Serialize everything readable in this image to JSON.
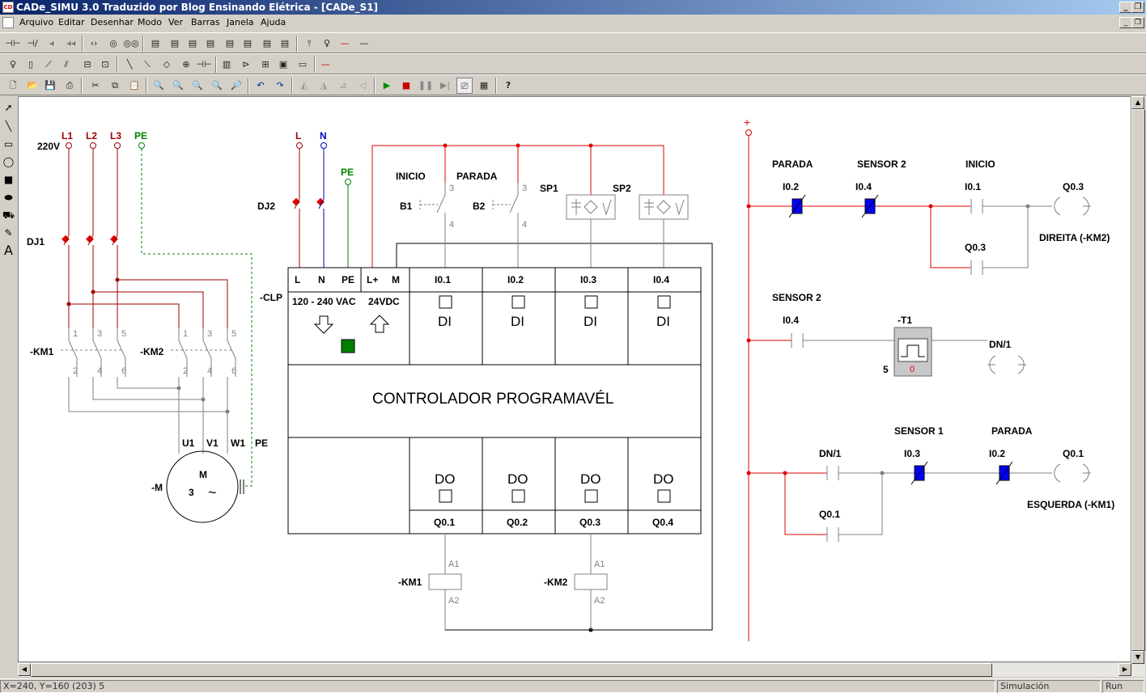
{
  "window": {
    "title": "CADe_SIMU 3.0 Traduzido por Blog Ensinando Elétrica - [CADe_S1]",
    "app_icon": "cade-simu-icon"
  },
  "menu": [
    "Arquivo",
    "Editar",
    "Desenhar",
    "Modo",
    "Ver",
    "Barras",
    "Janela",
    "Ajuda"
  ],
  "status": {
    "coords": "X=240, Y=160 (203) 5",
    "mode": "Simulación",
    "state": "Run"
  },
  "colors": {
    "phase": "#a00000",
    "neutral": "#0000c0",
    "earth": "#008000",
    "energized": "#e00000",
    "contact_active": "#0000ff",
    "led_on": "#008000"
  },
  "diagram": {
    "power": {
      "l1": "L1",
      "l2": "L2",
      "l3": "L3",
      "pe": "PE",
      "voltage": "220V",
      "breaker": "DJ1",
      "km1": "-KM1",
      "km2": "-KM2",
      "motor": "-M",
      "motor_m": "M",
      "motor_3": "3",
      "motor_tilde": "~",
      "u1": "U1",
      "v1": "V1",
      "w1": "W1",
      "pe2": "PE",
      "t1": "1",
      "t3": "3",
      "t5": "5",
      "t2": "2",
      "t4": "4",
      "t6": "6"
    },
    "clp_supply": {
      "l": "L",
      "n": "N",
      "pe": "PE",
      "breaker": "DJ2"
    },
    "inputs": {
      "inicio": "INICIO",
      "parada": "PARADA",
      "b1": "B1",
      "b2": "B2",
      "sp1": "SP1",
      "sp2": "SP2",
      "n3": "3",
      "n4": "4"
    },
    "plc": {
      "name": "-CLP",
      "title": "CONTROLADOR PROGRAMAVÉL",
      "t_l": "L",
      "t_n": "N",
      "t_pe": "PE",
      "t_lp": "L+",
      "t_m": "M",
      "ac": "120 - 240 VAC",
      "dc": "24VDC",
      "in": [
        "I0.1",
        "I0.2",
        "I0.3",
        "I0.4"
      ],
      "di": "DI",
      "out": [
        "Q0.1",
        "Q0.2",
        "Q0.3",
        "Q0.4"
      ],
      "do": "DO"
    },
    "coils": {
      "km1": "-KM1",
      "km2": "-KM2",
      "a1": "A1",
      "a2": "A2"
    },
    "ladder": {
      "plus": "+",
      "r1": {
        "lbl_parada": "PARADA",
        "lbl_sensor2": "SENSOR 2",
        "lbl_inicio": "INICIO",
        "i02": "I0.2",
        "i04": "I0.4",
        "i01": "I0.1",
        "q03": "Q0.3",
        "q03b": "Q0.3",
        "coil_text": "DIREITA (-KM2)"
      },
      "r2": {
        "lbl_sensor2": "SENSOR 2",
        "i04": "I0.4",
        "timer": "-T1",
        "preset": "5",
        "value": "0",
        "dn": "DN/1"
      },
      "r3": {
        "dn": "DN/1",
        "lbl_sensor1": "SENSOR 1",
        "i03": "I0.3",
        "lbl_parada": "PARADA",
        "i02": "I0.2",
        "q01": "Q0.1",
        "q01b": "Q0.1",
        "coil_text": "ESQUERDA (-KM1)"
      }
    }
  }
}
